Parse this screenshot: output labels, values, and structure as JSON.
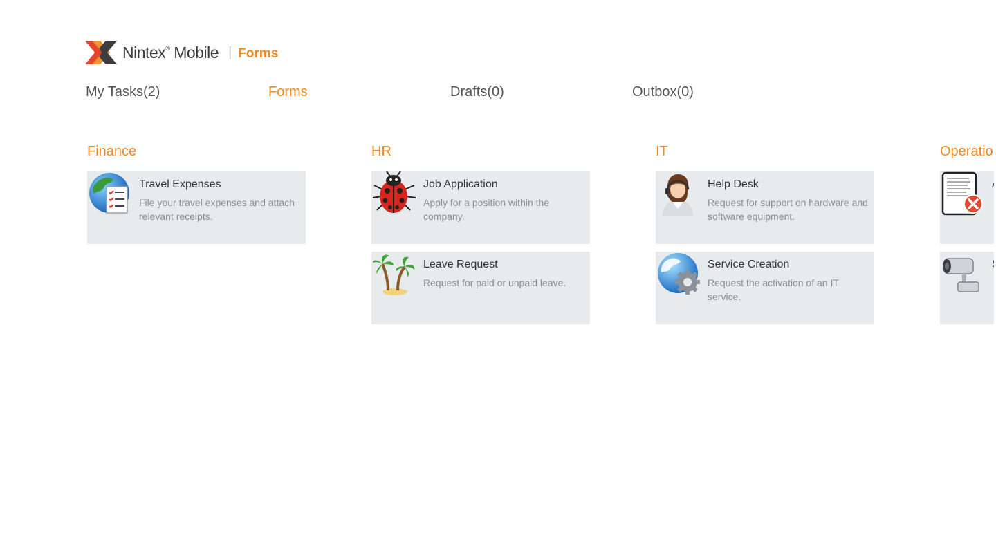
{
  "header": {
    "brand": "Nintex",
    "brand_tm": "®",
    "brand_suffix": "Mobile",
    "separator": "|",
    "app": "Forms"
  },
  "nav": {
    "tabs": [
      {
        "label": "My Tasks(2)",
        "active": false
      },
      {
        "label": "Forms",
        "active": true
      },
      {
        "label": "Drafts(0)",
        "active": false
      },
      {
        "label": "Outbox(0)",
        "active": false
      }
    ]
  },
  "groups": [
    {
      "title": "Finance",
      "forms": [
        {
          "title": "Travel Expenses",
          "description": "File your travel expenses and attach relevant receipts.",
          "icon": "globe-checklist-icon"
        }
      ]
    },
    {
      "title": "HR",
      "forms": [
        {
          "title": "Job Application",
          "description": "Apply for a position within the company.",
          "icon": "ladybug-icon"
        },
        {
          "title": "Leave Request",
          "description": "Request for paid or unpaid leave.",
          "icon": "palm-tree-icon"
        }
      ]
    },
    {
      "title": "IT",
      "forms": [
        {
          "title": "Help Desk",
          "description": "Request for support on hardware and software equipment.",
          "icon": "support-agent-icon"
        },
        {
          "title": "Service Creation",
          "description": "Request the activation of an IT service.",
          "icon": "globe-gear-icon"
        }
      ]
    },
    {
      "title": "Operatio",
      "forms": [
        {
          "title": "A",
          "description": "",
          "icon": "document-error-icon"
        },
        {
          "title": "S",
          "description": "",
          "icon": "security-camera-icon"
        }
      ]
    }
  ],
  "colors": {
    "accent": "#f0881f",
    "tile_bg": "#e8ebee",
    "text": "#333333",
    "muted": "#8a8f94"
  }
}
